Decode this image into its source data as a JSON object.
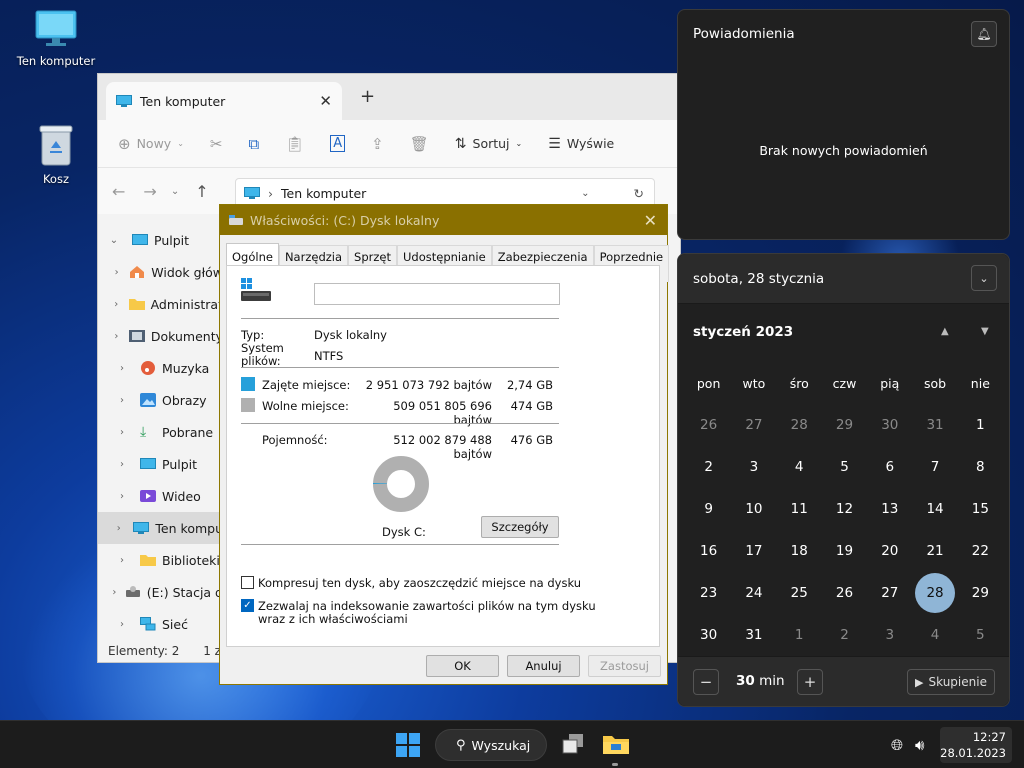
{
  "desktop": {
    "icons": [
      {
        "label": "Ten komputer",
        "icon": "monitor-icon"
      },
      {
        "label": "Kosz",
        "icon": "recycle-bin-icon"
      }
    ]
  },
  "explorer": {
    "tab_title": "Ten komputer",
    "toolbar": {
      "new_label": "Nowy",
      "sort_label": "Sortuj",
      "view_label": "Wyświe"
    },
    "address": "Ten komputer",
    "nav": [
      {
        "label": "Pulpit",
        "icon": "desktop-icon",
        "expanded": true
      },
      {
        "label": "Widok głów",
        "icon": "home-icon"
      },
      {
        "label": "Administrat",
        "icon": "folder-icon"
      },
      {
        "label": "Dokumenty",
        "icon": "documents-icon"
      },
      {
        "label": "Muzyka",
        "icon": "music-icon"
      },
      {
        "label": "Obrazy",
        "icon": "pictures-icon"
      },
      {
        "label": "Pobrane",
        "icon": "download-icon"
      },
      {
        "label": "Pulpit",
        "icon": "desktop-icon"
      },
      {
        "label": "Wideo",
        "icon": "video-icon"
      },
      {
        "label": "Ten kompu",
        "icon": "monitor-icon",
        "selected": true
      },
      {
        "label": "Biblioteki",
        "icon": "folder-icon"
      },
      {
        "label": "(E:) Stacja d",
        "icon": "drive-icon"
      },
      {
        "label": "Sieć",
        "icon": "network-icon"
      }
    ],
    "status_items": "Elementy: 2",
    "status_selected": "1 zaz"
  },
  "properties": {
    "title": "Właściwości: (C:) Dysk lokalny",
    "tabs": [
      "Ogólne",
      "Narzędzia",
      "Sprzęt",
      "Udostępnianie",
      "Zabezpieczenia",
      "Poprzednie wersje"
    ],
    "name_value": "",
    "type_label": "Typ:",
    "type_value": "Dysk lokalny",
    "fs_label": "System plików:",
    "fs_value": "NTFS",
    "used_label": "Zajęte miejsce:",
    "used_bytes": "2 951 073 792 bajtów",
    "used_gb": "2,74 GB",
    "free_label": "Wolne miejsce:",
    "free_bytes": "509 051 805 696 bajtów",
    "free_gb": "474 GB",
    "capacity_label": "Pojemność:",
    "capacity_bytes": "512 002 879 488 bajtów",
    "capacity_gb": "476 GB",
    "used_fraction": 0.0058,
    "drive_label": "Dysk C:",
    "details_button": "Szczegóły",
    "compress_label": "Kompresuj ten dysk, aby zaoszczędzić miejsce na dysku",
    "compress_checked": false,
    "index_label_1": "Zezwalaj na indeksowanie zawartości plików na tym dysku",
    "index_label_2": "wraz z ich właściwościami",
    "index_checked": true,
    "ok": "OK",
    "cancel": "Anuluj",
    "apply": "Zastosuj",
    "colors": {
      "used": "#26a0da",
      "free": "#b0b0b0",
      "titlebar": "#8a7000"
    }
  },
  "notifications": {
    "title": "Powiadomienia",
    "empty": "Brak nowych powiadomień"
  },
  "calendar": {
    "date_header": "sobota, 28 stycznia",
    "month": "styczeń 2023",
    "weekdays": [
      "pon",
      "wto",
      "śro",
      "czw",
      "pią",
      "sob",
      "nie"
    ],
    "days": [
      {
        "d": "26",
        "dim": true
      },
      {
        "d": "27",
        "dim": true
      },
      {
        "d": "28",
        "dim": true
      },
      {
        "d": "29",
        "dim": true
      },
      {
        "d": "30",
        "dim": true
      },
      {
        "d": "31",
        "dim": true
      },
      {
        "d": "1"
      },
      {
        "d": "2"
      },
      {
        "d": "3"
      },
      {
        "d": "4"
      },
      {
        "d": "5"
      },
      {
        "d": "6"
      },
      {
        "d": "7"
      },
      {
        "d": "8"
      },
      {
        "d": "9"
      },
      {
        "d": "10"
      },
      {
        "d": "11"
      },
      {
        "d": "12"
      },
      {
        "d": "13"
      },
      {
        "d": "14"
      },
      {
        "d": "15"
      },
      {
        "d": "16"
      },
      {
        "d": "17"
      },
      {
        "d": "18"
      },
      {
        "d": "19"
      },
      {
        "d": "20"
      },
      {
        "d": "21"
      },
      {
        "d": "22"
      },
      {
        "d": "23"
      },
      {
        "d": "24"
      },
      {
        "d": "25"
      },
      {
        "d": "26"
      },
      {
        "d": "27"
      },
      {
        "d": "28",
        "today": true
      },
      {
        "d": "29"
      },
      {
        "d": "30"
      },
      {
        "d": "31"
      },
      {
        "d": "1",
        "dim": true
      },
      {
        "d": "2",
        "dim": true
      },
      {
        "d": "3",
        "dim": true
      },
      {
        "d": "4",
        "dim": true
      },
      {
        "d": "5",
        "dim": true
      }
    ],
    "focus_minutes": "30",
    "focus_unit": "min",
    "focus_button": "Skupienie",
    "today_color": "#8fb5d6"
  },
  "taskbar": {
    "search_label": "Wyszukaj",
    "time": "12:27",
    "date": "28.01.2023"
  }
}
